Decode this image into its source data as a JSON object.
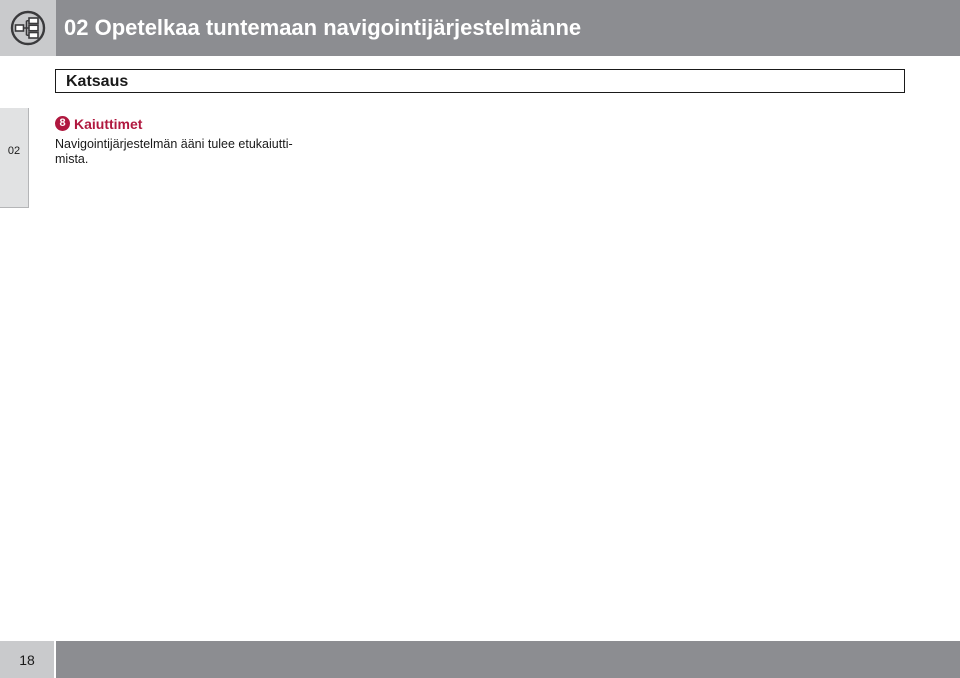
{
  "header": {
    "icon": "navigation-system-diagram-icon",
    "title": "02 Opetelkaa tuntemaan navigointijärjestelmänne"
  },
  "section": {
    "title": "Katsaus"
  },
  "chapter_tab": {
    "label": "02"
  },
  "item": {
    "number": "8",
    "title": "Kaiuttimet",
    "body_lines": [
      "Navigointijärjestelmän ääni tulee etukaiutti-",
      "mista."
    ]
  },
  "footer": {
    "page_number": "18"
  },
  "colors": {
    "header_bar": "#8c8d91",
    "header_icon_cell": "#c9cacc",
    "accent": "#b0183f",
    "chapter_tab": "#e1e2e3"
  }
}
